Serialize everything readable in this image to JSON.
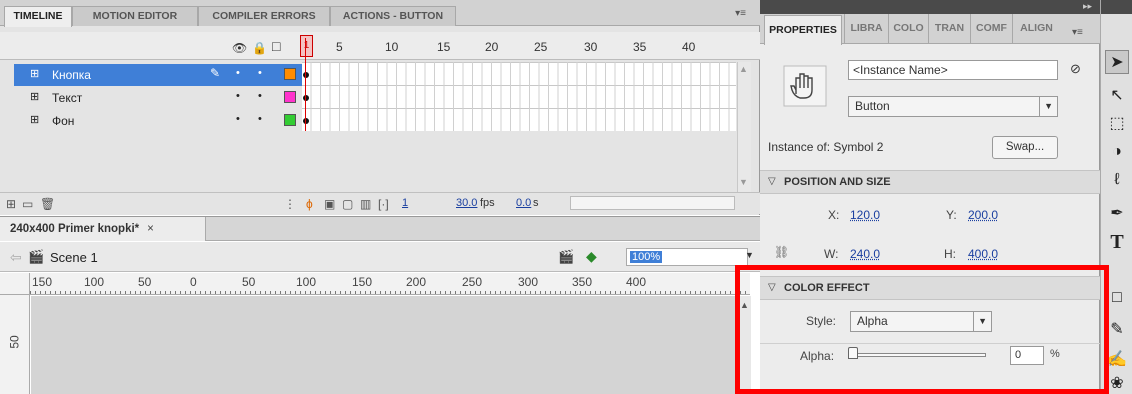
{
  "timeline_panel": {
    "tabs": [
      "TIMELINE",
      "MOTION EDITOR",
      "COMPILER ERRORS",
      "ACTIONS - BUTTON"
    ],
    "menu_glyph": "▾≡",
    "frame_numbers": [
      "5",
      "10",
      "15",
      "20",
      "25",
      "30",
      "35",
      "40"
    ],
    "current_frame": "1",
    "layers": [
      {
        "name": "Кнопка",
        "selected": true,
        "color": "#ff8c00"
      },
      {
        "name": "Текст",
        "selected": false,
        "color": "#ff33cc"
      },
      {
        "name": "Фон",
        "selected": false,
        "color": "#33cc33"
      }
    ],
    "footer": {
      "frame": "1",
      "fps": "30.0",
      "fps_unit": "fps",
      "time": "0.0",
      "time_unit": "s"
    }
  },
  "document": {
    "tab_title": "240x400 Primer knopki*",
    "tab_close": "×",
    "scene_label": "Scene 1",
    "zoom": "100%",
    "ruler_h_ticks": [
      "150",
      "100",
      "50",
      "0",
      "50",
      "100",
      "150",
      "200",
      "250",
      "300",
      "350",
      "400"
    ],
    "ruler_v_tick": "50"
  },
  "properties_panel": {
    "tabs": [
      "PROPERTIES",
      "LIBRA",
      "COLO",
      "TRAN",
      "COMF",
      "ALIGN"
    ],
    "menu_glyph": "▾≡",
    "instance_name_placeholder": "<Instance Name>",
    "instance_type": "Button",
    "instance_of_label": "Instance of:",
    "instance_of_value": "Symbol 2",
    "swap_button": "Swap...",
    "position_section": "POSITION AND SIZE",
    "x_label": "X:",
    "x_value": "120.0",
    "y_label": "Y:",
    "y_value": "200.0",
    "w_label": "W:",
    "w_value": "240.0",
    "h_label": "H:",
    "h_value": "400.0",
    "color_section": "COLOR EFFECT",
    "style_label": "Style:",
    "style_value": "Alpha",
    "alpha_label": "Alpha:",
    "alpha_value": "0",
    "alpha_unit": "%",
    "alpha_level": 0
  },
  "tools_panel": {
    "icons": [
      "selection-tool",
      "subselection-tool",
      "free-transform-tool",
      "3d-rotation-tool",
      "lasso-tool",
      "pen-tool",
      "text-tool"
    ]
  },
  "colors": {
    "selection": "#3f7fd7",
    "playhead": "#dd0000",
    "highlight": "#ff0000",
    "link_value": "#1a3fa0"
  }
}
